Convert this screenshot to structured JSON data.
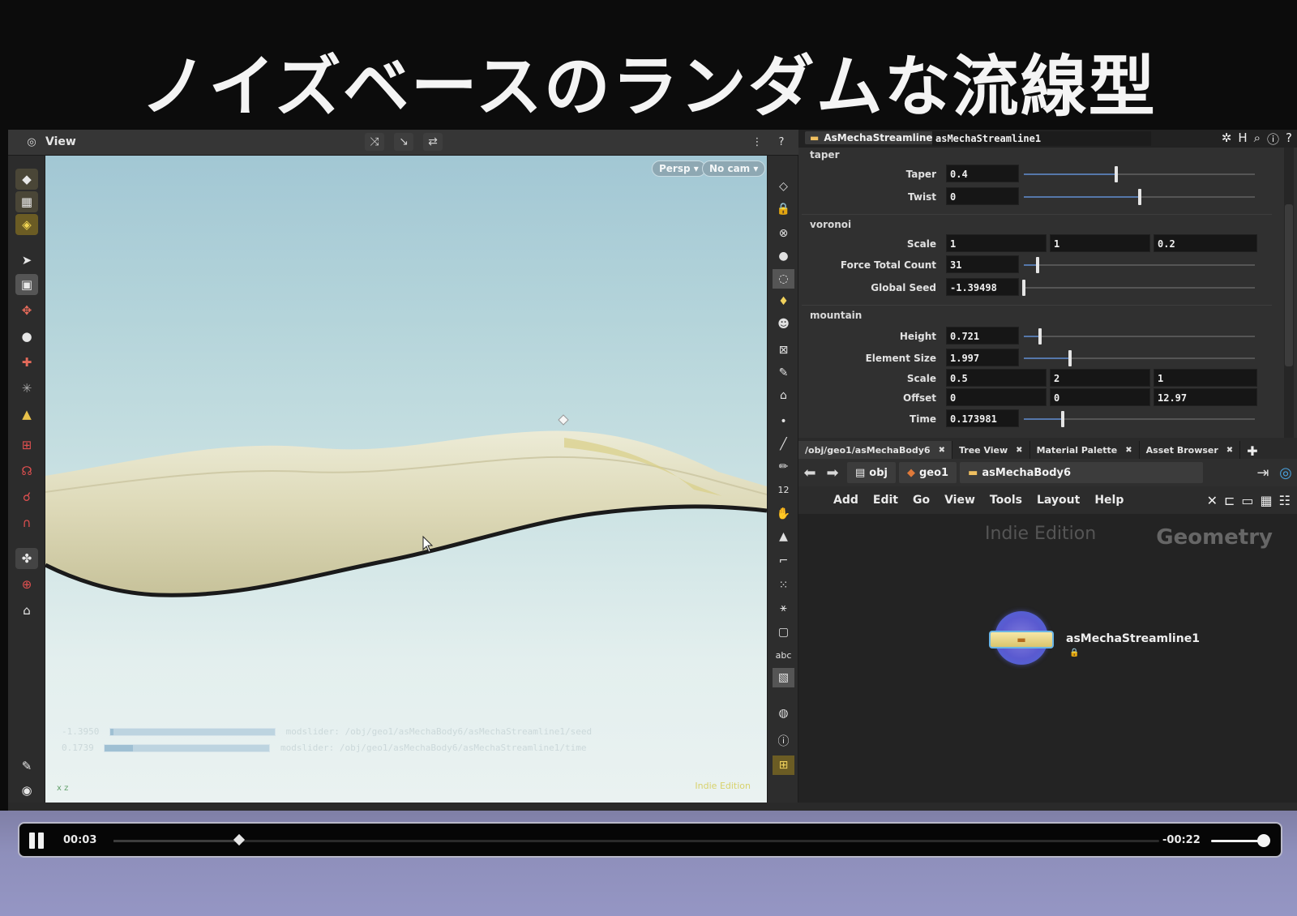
{
  "slide": {
    "title": "ノイズベースのランダムな流線型"
  },
  "viewport": {
    "header_label": "View",
    "persp_label": "Persp",
    "cam_label": "No cam",
    "hud_lines": [
      {
        "value": "-1.3950",
        "fill_fraction": 0.02,
        "text": "modslider: /obj/geo1/asMechaBody6/asMechaStreamline1/seed"
      },
      {
        "value": "0.1739",
        "fill_fraction": 0.17,
        "text": "modslider: /obj/geo1/asMechaBody6/asMechaStreamline1/time"
      }
    ],
    "indie_label": "Indie Edition",
    "axis_label": "x z"
  },
  "params": {
    "node_type": "AsMechaStreamline",
    "node_name": "asMechaStreamline1",
    "folders": {
      "taper": "taper",
      "voronoi": "voronoi",
      "mountain": "mountain"
    },
    "taper": {
      "label": "Taper",
      "value": "0.4",
      "slider": 0.4
    },
    "twist": {
      "label": "Twist",
      "value": "0",
      "slider": 0.5
    },
    "v_scale": {
      "label": "Scale",
      "values": [
        "1",
        "1",
        "0.2"
      ]
    },
    "force_total_count": {
      "label": "Force Total Count",
      "value": "31",
      "slider": 0.06
    },
    "global_seed": {
      "label": "Global Seed",
      "value": "-1.39498",
      "slider": 0.0
    },
    "height": {
      "label": "Height",
      "value": "0.721",
      "slider": 0.07
    },
    "element_size": {
      "label": "Element Size",
      "value": "1.997",
      "slider": 0.2
    },
    "m_scale": {
      "label": "Scale",
      "values": [
        "0.5",
        "2",
        "1"
      ]
    },
    "offset": {
      "label": "Offset",
      "values": [
        "0",
        "0",
        "12.97"
      ]
    },
    "time": {
      "label": "Time",
      "value": "0.173981",
      "slider": 0.17
    }
  },
  "network": {
    "tabs": [
      {
        "label": "/obj/geo1/asMechaBody6"
      },
      {
        "label": "Tree View"
      },
      {
        "label": "Material Palette"
      },
      {
        "label": "Asset Browser"
      }
    ],
    "path": {
      "root": "obj",
      "geo": "geo1",
      "body": "asMechaBody6"
    },
    "menu": [
      "Add",
      "Edit",
      "Go",
      "View",
      "Tools",
      "Layout",
      "Help"
    ],
    "watermark_edition": "Indie Edition",
    "watermark_context": "Geometry",
    "node_label": "asMechaStreamline1"
  },
  "player": {
    "current_time": "00:03",
    "remaining_time": "-00:22",
    "progress_fraction": 0.12,
    "volume_fraction": 0.9
  },
  "colors": {
    "accent_red": "#c23b4f",
    "slider_fill": "#5577aa",
    "node_ring": "#5a5ad0"
  }
}
